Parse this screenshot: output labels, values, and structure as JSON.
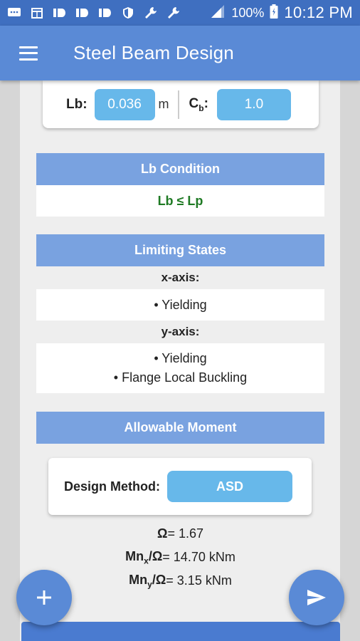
{
  "status_bar": {
    "battery": "100%",
    "time": "10:12 PM",
    "icons": [
      "message-icon",
      "calendar-icon",
      "app-icon",
      "app-icon",
      "app-icon",
      "shield-icon",
      "wrench-icon",
      "wrench-icon",
      "signal-icon",
      "battery-icon"
    ]
  },
  "app_bar": {
    "title": "Steel Beam Design"
  },
  "inputs": {
    "lb_label": "Lb:",
    "lb_value": "0.036",
    "lb_unit": "m",
    "cb_label": "C",
    "cb_sub": "b",
    "cb_colon": ":",
    "cb_value": "1.0"
  },
  "lb_condition": {
    "header": "Lb Condition",
    "value": "Lb ≤ Lp"
  },
  "limiting_states": {
    "header": "Limiting States",
    "x_label": "x-axis:",
    "x_items": [
      "• Yielding"
    ],
    "y_label": "y-axis:",
    "y_items": [
      "• Yielding",
      "• Flange Local Buckling"
    ]
  },
  "allowable_moment": {
    "header": "Allowable Moment",
    "method_label": "Design Method:",
    "method_value": "ASD",
    "omega_label": "Ω",
    "omega_value": " = 1.67",
    "mnx_prefix": "Mn",
    "mnx_sub": "x",
    "mnx_suffix": "/Ω",
    "mnx_value": " = 14.70 kNm",
    "mny_prefix": "Mn",
    "mny_sub": "y",
    "mny_suffix": "/Ω",
    "mny_value": " = 3.15 kNm"
  },
  "colors": {
    "status_bar": "#3f6fc0",
    "app_bar": "#5a8ad6",
    "section_header": "#79a2e0",
    "input_pill": "#67b8ea",
    "success_green": "#1f7a24"
  }
}
